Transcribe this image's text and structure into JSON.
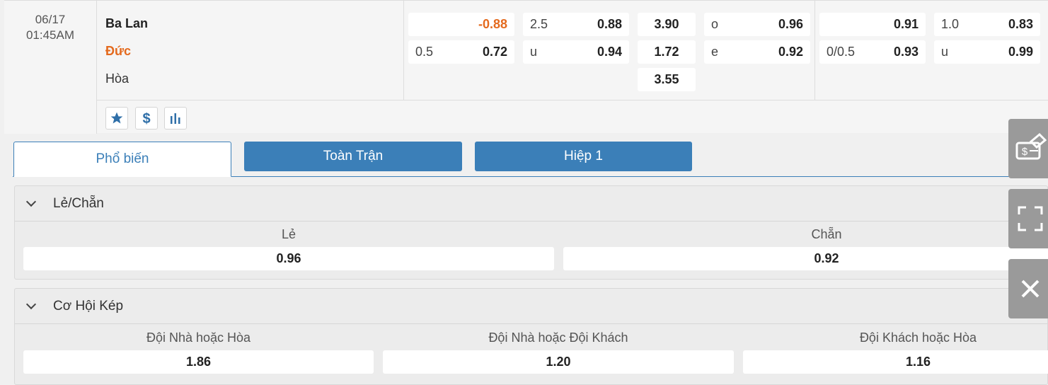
{
  "match": {
    "date": "06/17",
    "time": "01:45AM",
    "home": "Ba Lan",
    "away": "Đức",
    "draw": "Hòa"
  },
  "odds": {
    "hdp_home_val": "-0.88",
    "hdp_away_line": "0.5",
    "hdp_away_val": "0.72",
    "ou_line": "2.5",
    "ou_over_val": "0.88",
    "ou_under_label": "u",
    "ou_under_val": "0.94",
    "x12_home": "3.90",
    "x12_away": "1.72",
    "x12_draw": "3.55",
    "oe_odd_label": "o",
    "oe_odd_val": "0.96",
    "oe_even_label": "e",
    "oe_even_val": "0.92",
    "h1_hdp_home_val": "0.91",
    "h1_hdp_line": "0/0.5",
    "h1_hdp_away_val": "0.93",
    "h1_ou_line": "1.0",
    "h1_ou_over_val": "0.83",
    "h1_ou_under_label": "u",
    "h1_ou_under_val": "0.99"
  },
  "tabs": {
    "popular": "Phổ biến",
    "full_match": "Toàn Trận",
    "first_half": "Hiệp 1"
  },
  "odd_even": {
    "title": "Lẻ/Chẵn",
    "odd_label": "Lẻ",
    "odd_val": "0.96",
    "even_label": "Chẵn",
    "even_val": "0.92"
  },
  "double_chance": {
    "title": "Cơ Hội Kép",
    "opt1_label": "Đội Nhà hoặc Hòa",
    "opt1_val": "1.86",
    "opt2_label": "Đội Nhà hoặc Đội Khách",
    "opt2_val": "1.20",
    "opt3_label": "Đội Khách hoặc Hòa",
    "opt3_val": "1.16"
  },
  "icons": {
    "favorite": "star-icon",
    "bet": "dollar-icon",
    "stats": "bar-chart-icon",
    "betslip": "betslip-icon",
    "fullscreen": "fullscreen-icon",
    "close": "close-icon"
  },
  "colors": {
    "accent": "#3b7fb8",
    "away_team": "#e46a1e",
    "side_button": "#9a9a9a"
  }
}
